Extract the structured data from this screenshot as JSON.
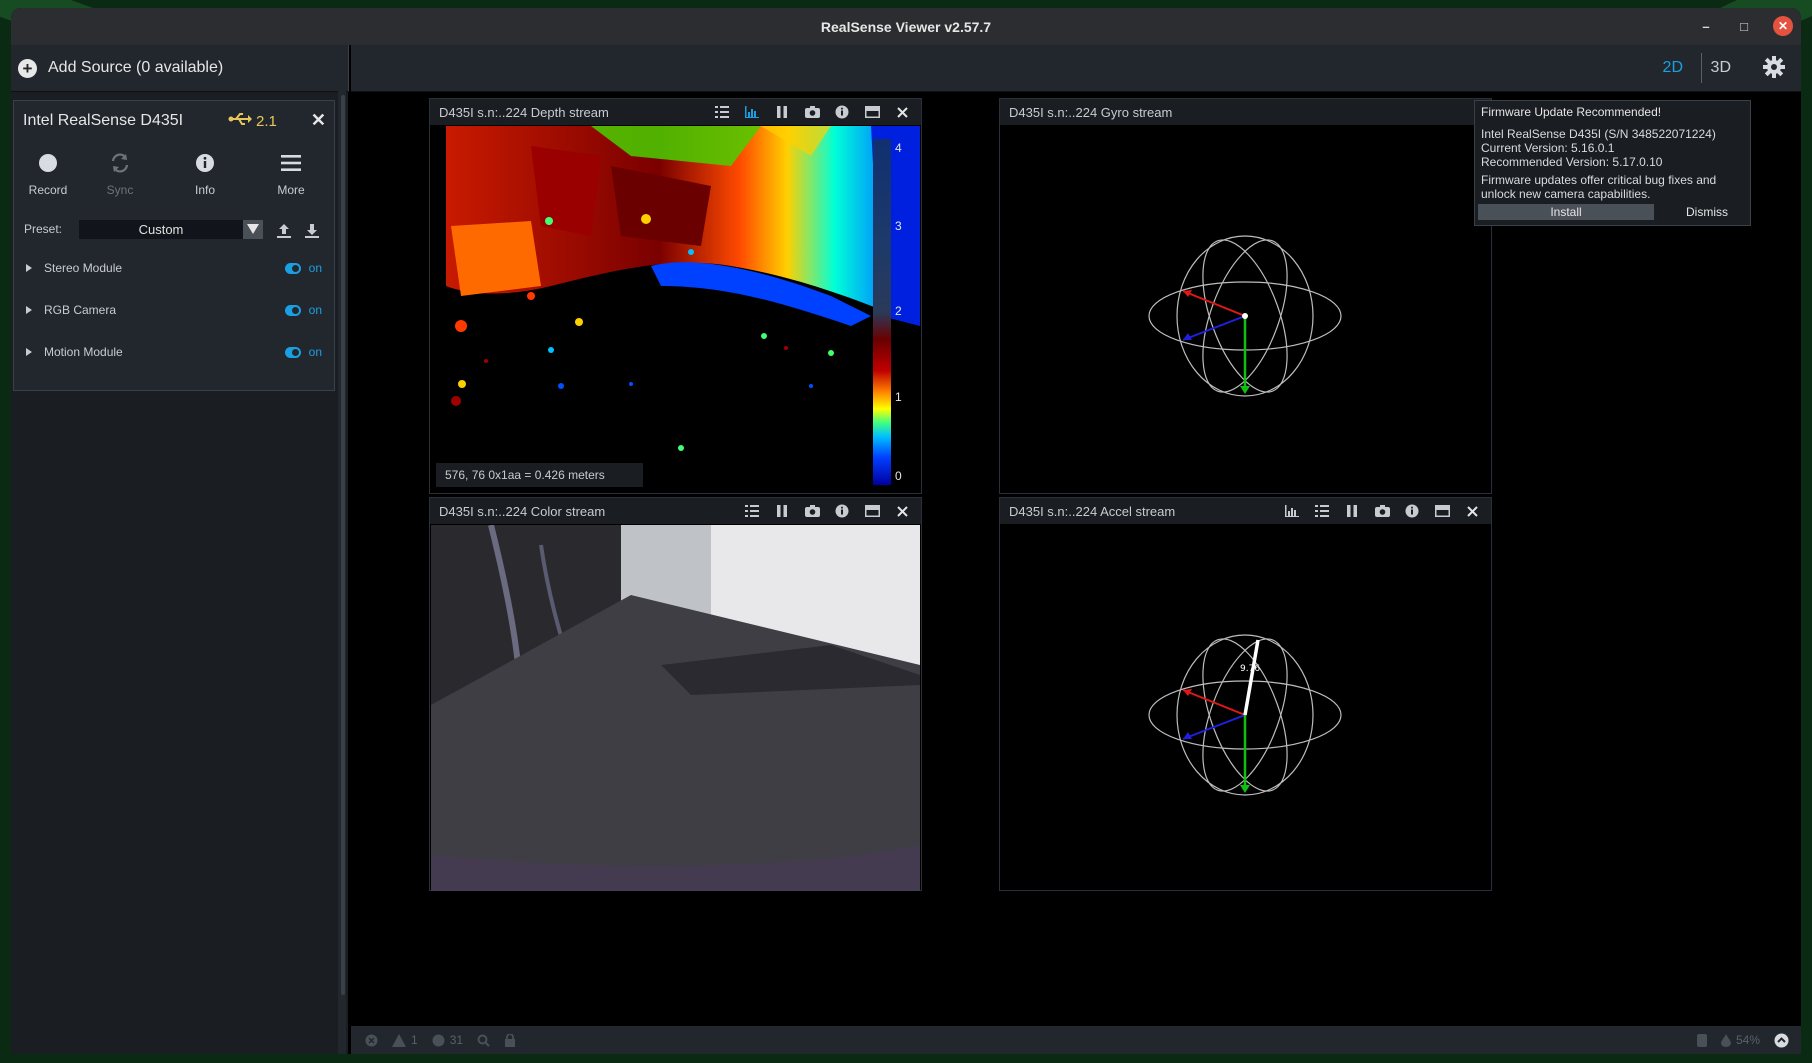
{
  "window": {
    "title": "RealSense Viewer v2.57.7"
  },
  "sidebar": {
    "add_source_label": "Add Source (0 available)",
    "device": {
      "name": "Intel RealSense D435I",
      "usb_version": "2.1",
      "actions": [
        {
          "label": "Record",
          "icon": "record-icon"
        },
        {
          "label": "Sync",
          "icon": "sync-icon"
        },
        {
          "label": "Info",
          "icon": "info-icon"
        },
        {
          "label": "More",
          "icon": "menu-icon"
        }
      ],
      "preset_label": "Preset:",
      "preset_value": "Custom",
      "modules": [
        {
          "label": "Stereo Module",
          "state": "on"
        },
        {
          "label": "RGB Camera",
          "state": "on"
        },
        {
          "label": "Motion Module",
          "state": "on"
        }
      ]
    }
  },
  "topbar": {
    "view_2d": "2D",
    "view_3d": "3D"
  },
  "streams": {
    "depth": {
      "title": "D435I s.n:..224 Depth stream",
      "readout": "576, 76 0x1aa = 0.426 meters",
      "colorbar_ticks": [
        "4",
        "3",
        "2",
        "1",
        "0"
      ]
    },
    "color": {
      "title": "D435I s.n:..224 Color stream"
    },
    "gyro": {
      "title": "D435I s.n:..224 Gyro stream"
    },
    "accel": {
      "title": "D435I s.n:..224 Accel stream",
      "magnitude": "9.76"
    }
  },
  "firmware_popup": {
    "title": "Firmware Update Recommended!",
    "device_line": "Intel RealSense D435I    (S/N 348522071224)",
    "current": "Current Version: 5.16.0.1",
    "recommended": "Recommended Version: 5.17.0.10",
    "message_1": "Firmware updates offer critical bug fixes and",
    "message_2": "unlock new camera capabilities.",
    "install_label": "Install",
    "dismiss_label": "Dismiss"
  },
  "status_bar": {
    "warnings": "1",
    "info": "31",
    "cpu": "54%"
  }
}
